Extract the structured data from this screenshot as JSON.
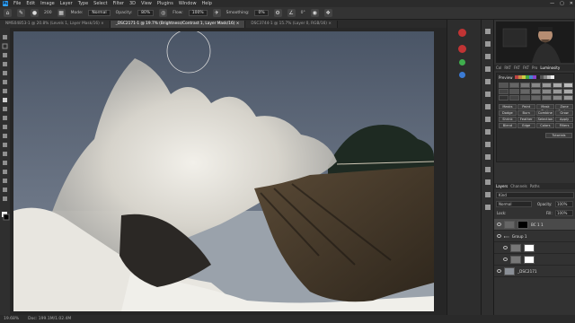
{
  "menubar": {
    "logo": "Ps",
    "items": [
      "File",
      "Edit",
      "Image",
      "Layer",
      "Type",
      "Select",
      "Filter",
      "3D",
      "View",
      "Plugins",
      "Window",
      "Help"
    ],
    "window_controls": [
      "—",
      "▢",
      "✕"
    ]
  },
  "options": {
    "mode_label": "Mode:",
    "mode_value": "Normal",
    "opacity_label": "Opacity:",
    "opacity_value": "80%",
    "flow_label": "Flow:",
    "flow_value": "100%",
    "smoothing_label": "Smoothing:",
    "smoothing_value": "0%",
    "brush_size": "200",
    "angle_value": "0°"
  },
  "tabs": [
    {
      "label": "NMS04853-1 @ 20.8% (Levels 1, Layer Mask/16) ×",
      "active": false
    },
    {
      "label": "_DSC2171-1 @ 19.7% (Brightness/Contrast 1, Layer Mask/16) ×",
      "active": true
    },
    {
      "label": "DSC3744-1 @ 15.7% (Layer 0, RGB/16) ×",
      "active": false
    }
  ],
  "status": {
    "zoom": "19.68%",
    "doc": "Doc: 199.1M/1.02.4M"
  },
  "right": {
    "top_tabs": [
      "Col",
      "RKT",
      "FKT",
      "FKT",
      "Pro",
      "Luminosity"
    ],
    "lum_label": "Preview",
    "sections": [
      "Masks",
      "Paint",
      "Mask Tools",
      "Zone System",
      "Dodge",
      "Burn",
      "Combine",
      "Grow",
      "Shrink",
      "Feather",
      "Selection",
      "Apply",
      "Blend",
      "Edge",
      "Colors",
      "Filters",
      "Tutorials"
    ],
    "layers_tabs": [
      "Layers",
      "Channels",
      "Paths"
    ],
    "kind_label": "Kind",
    "blend_mode": "Normal",
    "opacity_label": "Opacity:",
    "opacity_value": "100%",
    "lock_label": "Lock:",
    "fill_label": "Fill:",
    "fill_value": "100%",
    "layers": [
      {
        "name": "BC 1 1",
        "type": "adjustment"
      },
      {
        "name": "Group 1",
        "type": "group"
      },
      {
        "name": "",
        "type": "adjustment"
      },
      {
        "name": "",
        "type": "adjustment"
      },
      {
        "name": "_DSC2171",
        "type": "image"
      }
    ]
  },
  "colors": {
    "accent": "#2fa3ff",
    "panel": "#323232",
    "dark": "#252525"
  }
}
